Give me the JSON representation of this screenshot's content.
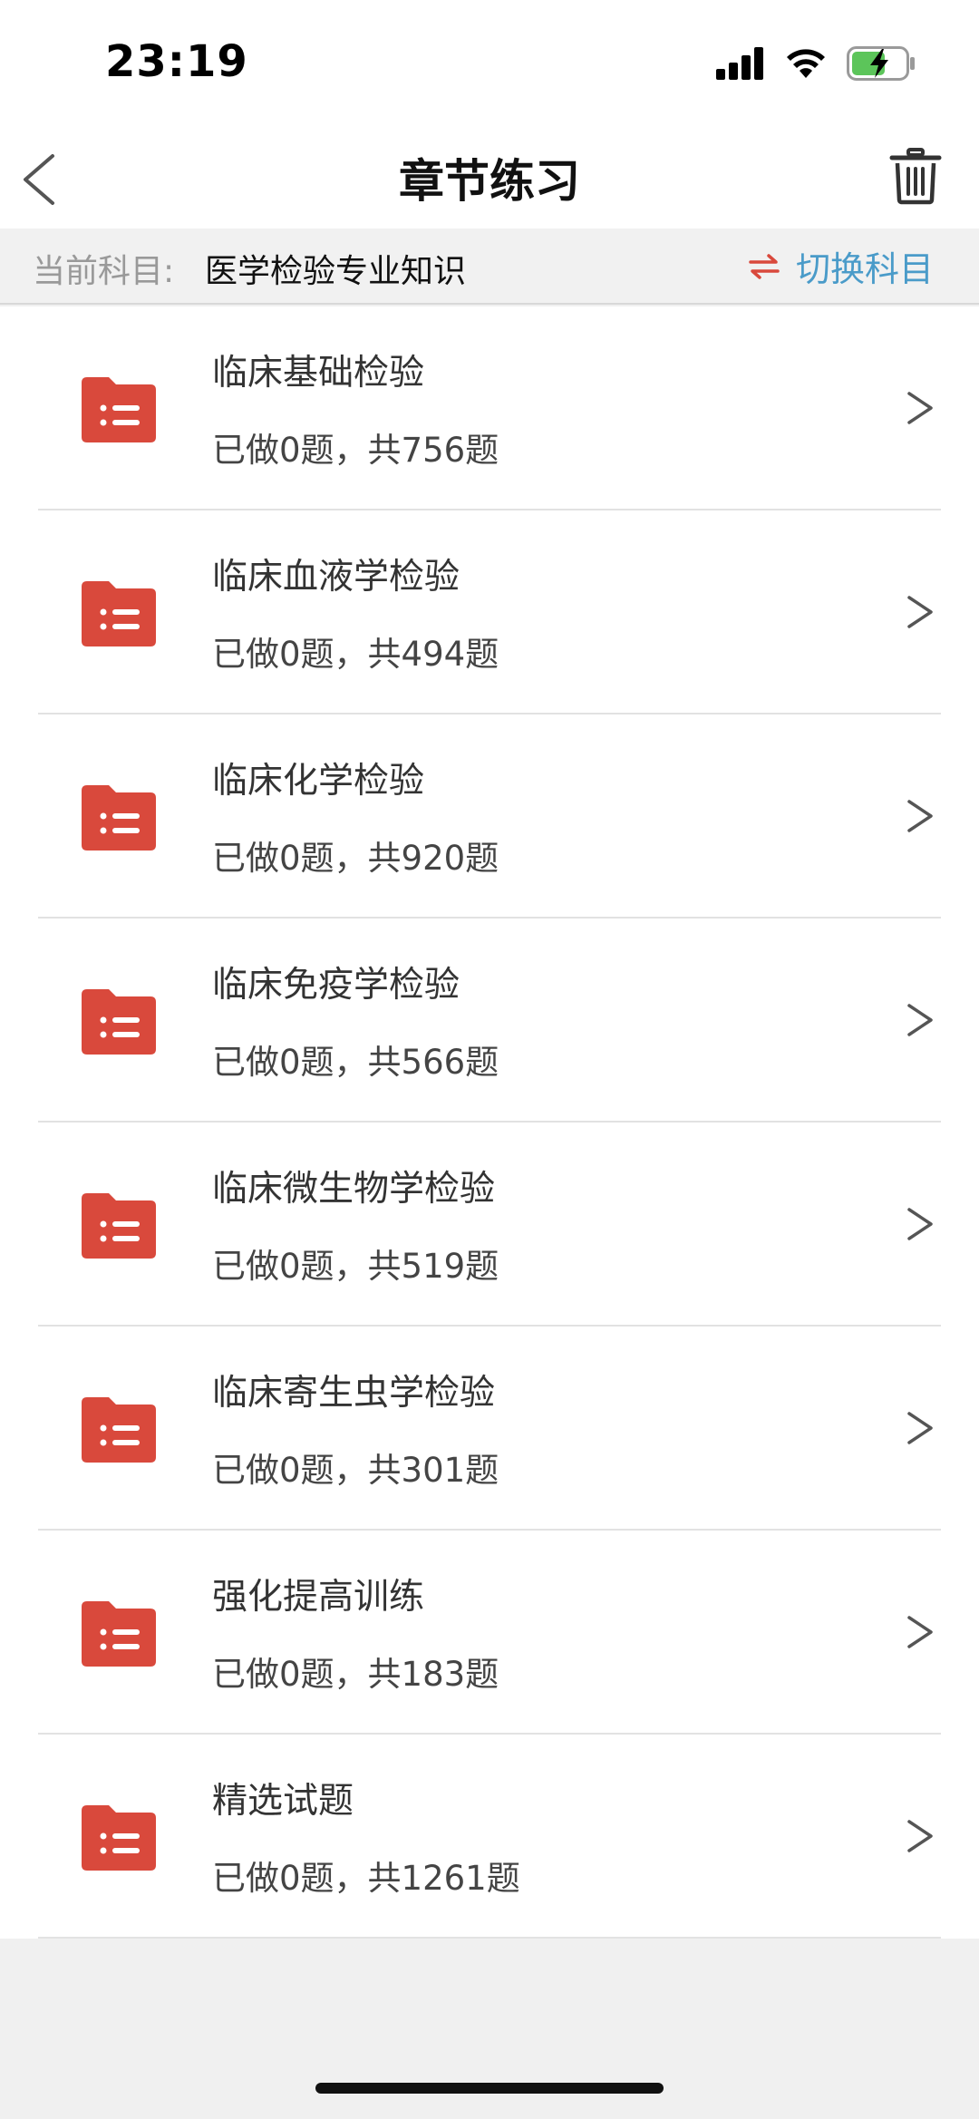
{
  "status": {
    "time": "23:19"
  },
  "header": {
    "title": "章节练习",
    "back_icon": "chevron-left-icon",
    "trash_icon": "trash-icon"
  },
  "subject": {
    "label": "当前科目:",
    "value": "医学检验专业知识",
    "switch_label": "切换科目",
    "switch_icon": "swap-arrows-icon"
  },
  "colors": {
    "accent_red": "#d9493c",
    "switch_blue": "#4a9bc9"
  },
  "chapters": [
    {
      "title": "临床基础检验",
      "progress": "已做0题，共756题"
    },
    {
      "title": "临床血液学检验",
      "progress": "已做0题，共494题"
    },
    {
      "title": "临床化学检验",
      "progress": "已做0题，共920题"
    },
    {
      "title": "临床免疫学检验",
      "progress": "已做0题，共566题"
    },
    {
      "title": "临床微生物学检验",
      "progress": "已做0题，共519题"
    },
    {
      "title": "临床寄生虫学检验",
      "progress": "已做0题，共301题"
    },
    {
      "title": "强化提高训练",
      "progress": "已做0题，共183题"
    },
    {
      "title": "精选试题",
      "progress": "已做0题，共1261题"
    }
  ]
}
